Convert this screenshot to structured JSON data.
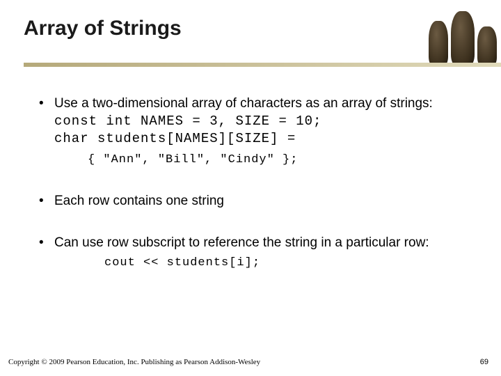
{
  "slide": {
    "title": "Array of Strings",
    "bullets": [
      {
        "text": "Use a two-dimensional array of characters as an array of strings:",
        "code_lines": [
          "const int NAMES = 3, SIZE = 10;",
          "char students[NAMES][SIZE] ="
        ],
        "sub_code": "{ \"Ann\", \"Bill\", \"Cindy\" };"
      },
      {
        "text": "Each row contains one string"
      },
      {
        "text": "Can use row subscript to reference the string in a particular row:",
        "sub_code2": "cout << students[i];"
      }
    ],
    "copyright": "Copyright © 2009 Pearson Education, Inc. Publishing as Pearson Addison-Wesley",
    "page_number": "69"
  }
}
